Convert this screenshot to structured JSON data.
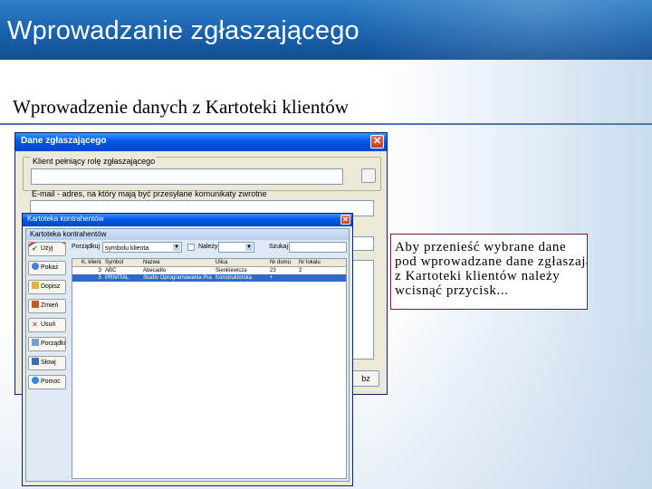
{
  "slide": {
    "title": "Wprowadzanie zgłaszającego",
    "subtitle": "Wprowadzenie danych z Kartoteki klientów"
  },
  "colors": {
    "header": "#1a62ad",
    "accent_rule": "#3a7cc0",
    "window_titlebar": "#0058e6",
    "highlight_ring": "#c0205a",
    "selected_row": "#316ac5"
  },
  "back_window": {
    "title": "Dane zgłaszającego",
    "close_icon": "close-icon",
    "client_legend": "Klient    pełniący rolę zgłaszającego",
    "email_label": "E-mail - adres, na który mają być przesyłane komunikaty zwrotne",
    "right_button": "bz"
  },
  "front_window": {
    "title": "Kartoteka kontrahentów",
    "panel_title": "Kartoteka kontrahentów",
    "buttons": [
      {
        "label": "Użyj",
        "icon": "check-icon"
      },
      {
        "label": "Pokaż",
        "icon": "view-icon"
      },
      {
        "label": "Dopisz",
        "icon": "add-icon"
      },
      {
        "label": "Zmień",
        "icon": "edit-icon"
      },
      {
        "label": "Usuń",
        "icon": "delete-icon"
      },
      {
        "label": "Porządki",
        "icon": "sort-icon"
      },
      {
        "label": "Słowj",
        "icon": "dictionary-icon"
      },
      {
        "label": "Pomoc",
        "icon": "help-icon"
      }
    ],
    "filter": {
      "sort_label": "Porządkuj",
      "sort_value": "symbolu klienta",
      "include_label": "Należy",
      "search_label": "Szukaj"
    },
    "grid": {
      "headers": [
        "K. klienta",
        "Symbol",
        "Nazwa",
        "Ulica",
        "Nr domu",
        "Nr lokalu"
      ],
      "rows": [
        [
          "3",
          "ABC",
          "Abecadło",
          "Sienkiewicza",
          "23",
          "2"
        ],
        [
          "5",
          "PRIVITAL",
          "Studio Oprogramowania Praktek sc",
          "Konstruktorska",
          "+",
          ""
        ]
      ]
    }
  },
  "callout": {
    "lines": [
      "Aby przenieść wybrane dane",
      "pod wprowadzane dane zgłaszającego",
      "z Kartoteki klientów należy",
      "wcisnąć przycisk..."
    ]
  }
}
